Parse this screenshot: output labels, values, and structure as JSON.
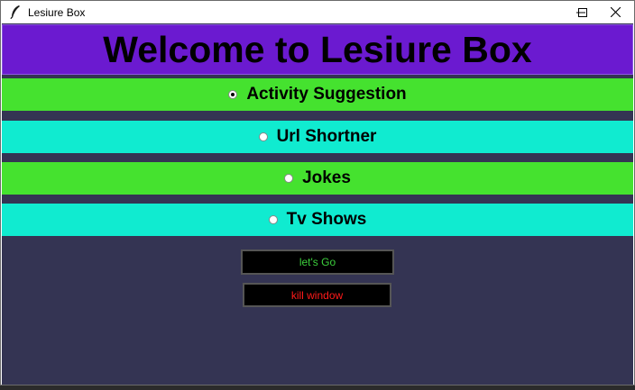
{
  "window": {
    "title": "Lesiure Box",
    "controls": [
      "minimize",
      "maximize",
      "close"
    ]
  },
  "colors": {
    "background": "#343453",
    "header": "#6b1ad0",
    "green_band": "#45e22f",
    "cyan_band": "#10ebd0",
    "go_text": "#3ccf3c",
    "kill_text": "#ff1a1a"
  },
  "header": {
    "text": "Welcome to Lesiure Box"
  },
  "options": [
    {
      "label": "Activity Suggestion",
      "selected": true
    },
    {
      "label": "Url Shortner",
      "selected": false
    },
    {
      "label": "Jokes",
      "selected": false
    },
    {
      "label": "Tv Shows",
      "selected": false
    }
  ],
  "buttons": {
    "go_label": "let's Go",
    "kill_label": "kill window"
  }
}
